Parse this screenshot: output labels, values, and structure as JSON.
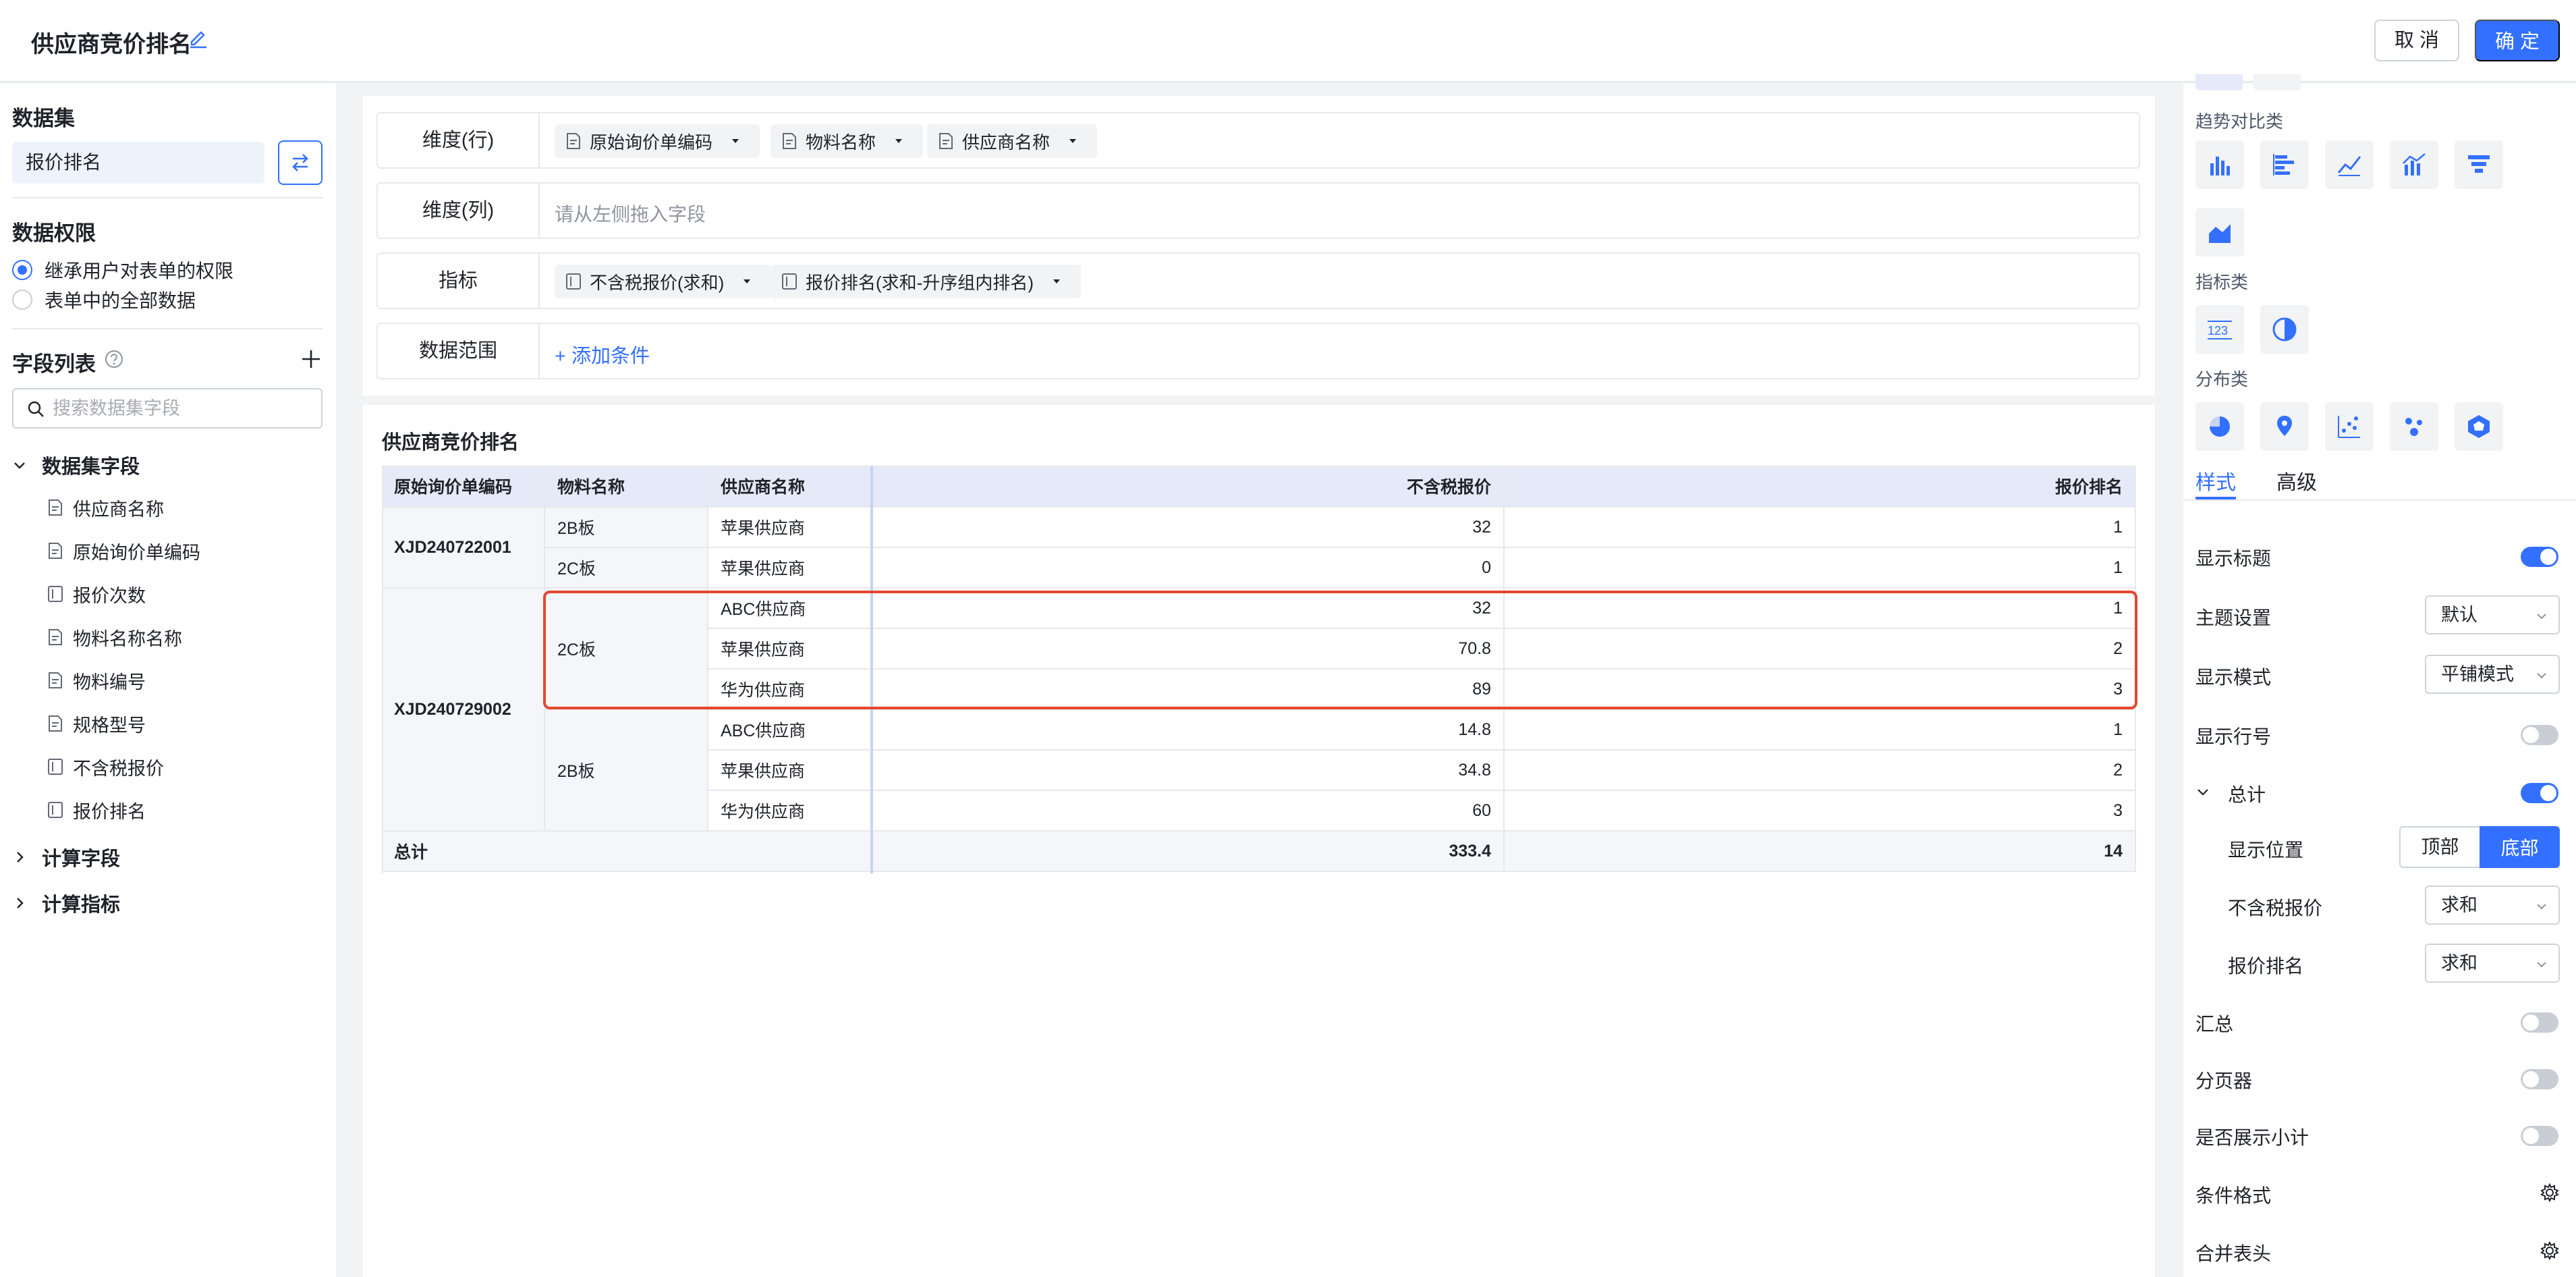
{
  "header": {
    "title": "供应商竞价排名",
    "cancel_label": "取 消",
    "ok_label": "确 定"
  },
  "left": {
    "dataset_title": "数据集",
    "dataset_name": "报价排名",
    "permission_title": "数据权限",
    "permission_options": [
      "继承用户对表单的权限",
      "表单中的全部数据"
    ],
    "field_list_title": "字段列表",
    "search_placeholder": "搜索数据集字段",
    "dataset_fields_group": "数据集字段",
    "fields": [
      {
        "label": "供应商名称",
        "kind": "text"
      },
      {
        "label": "原始询价单编码",
        "kind": "text"
      },
      {
        "label": "报价次数",
        "kind": "number"
      },
      {
        "label": "物料名称名称",
        "kind": "text"
      },
      {
        "label": "物料编号",
        "kind": "text"
      },
      {
        "label": "规格型号",
        "kind": "text"
      },
      {
        "label": "不含税报价",
        "kind": "number"
      },
      {
        "label": "报价排名",
        "kind": "number"
      }
    ],
    "calc_fields_group": "计算字段",
    "calc_metrics_group": "计算指标"
  },
  "config": {
    "row_dim_label": "维度(行)",
    "row_dims": [
      "原始询价单编码",
      "物料名称",
      "供应商名称"
    ],
    "col_dim_label": "维度(列)",
    "col_dim_placeholder": "请从左侧拖入字段",
    "metric_label": "指标",
    "metrics": [
      "不含税报价(求和)",
      "报价排名(求和-升序组内排名)"
    ],
    "range_label": "数据范围",
    "add_condition": "+ 添加条件"
  },
  "table": {
    "title": "供应商竞价排名",
    "headers": [
      "原始询价单编码",
      "物料名称",
      "供应商名称",
      "不含税报价",
      "报价排名"
    ],
    "groups": [
      {
        "code": "XJD240722001",
        "materials": [
          {
            "name": "2B板",
            "rows": [
              {
                "supplier": "苹果供应商",
                "price": "32",
                "rank": "1"
              }
            ]
          },
          {
            "name": "2C板",
            "rows": [
              {
                "supplier": "苹果供应商",
                "price": "0",
                "rank": "1"
              }
            ]
          }
        ]
      },
      {
        "code": "XJD240729002",
        "materials": [
          {
            "name": "2C板",
            "rows": [
              {
                "supplier": "ABC供应商",
                "price": "32",
                "rank": "1"
              },
              {
                "supplier": "苹果供应商",
                "price": "70.8",
                "rank": "2"
              },
              {
                "supplier": "华为供应商",
                "price": "89",
                "rank": "3"
              }
            ]
          },
          {
            "name": "2B板",
            "rows": [
              {
                "supplier": "ABC供应商",
                "price": "14.8",
                "rank": "1"
              },
              {
                "supplier": "苹果供应商",
                "price": "34.8",
                "rank": "2"
              },
              {
                "supplier": "华为供应商",
                "price": "60",
                "rank": "3"
              }
            ]
          }
        ]
      }
    ],
    "total_label": "总计",
    "total_price": "333.4",
    "total_rank": "14"
  },
  "right": {
    "cat_trend": "趋势对比类",
    "cat_metric": "指标类",
    "cat_dist": "分布类",
    "tab_style": "样式",
    "tab_advanced": "高级",
    "show_title": "显示标题",
    "show_title_on": true,
    "theme": "主题设置",
    "theme_value": "默认",
    "display_mode": "显示模式",
    "display_mode_value": "平铺模式",
    "show_row_num": "显示行号",
    "show_row_num_on": false,
    "grand_total": "总计",
    "grand_total_on": true,
    "position": "显示位置",
    "position_top": "顶部",
    "position_bottom": "底部",
    "position_selected": "底部",
    "price_agg_label": "不含税报价",
    "price_agg_value": "求和",
    "rank_agg_label": "报价排名",
    "rank_agg_value": "求和",
    "summary": "汇总",
    "summary_on": false,
    "pager": "分页器",
    "pager_on": false,
    "subtotal": "是否展示小计",
    "subtotal_on": false,
    "cond_format": "条件格式",
    "merge_header": "合并表头"
  },
  "colors": {
    "accent": "#3370ff",
    "highlight": "#e3472f",
    "header_bg": "#e6eaf8"
  }
}
